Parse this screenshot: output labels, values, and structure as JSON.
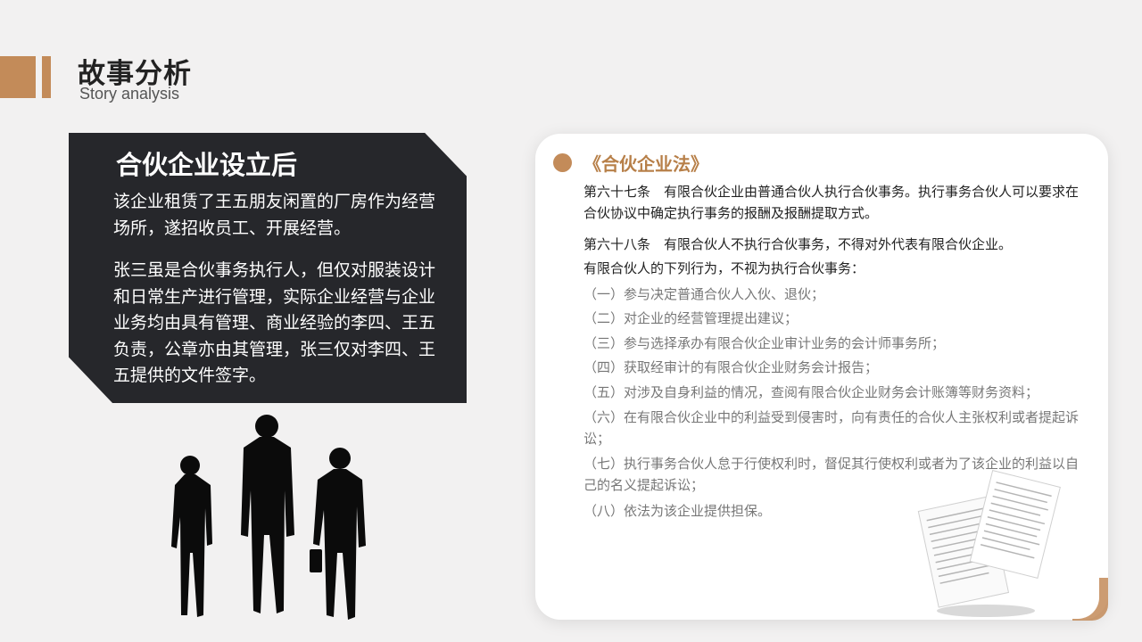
{
  "header": {
    "title": "故事分析",
    "subtitle": "Story analysis"
  },
  "story_card": {
    "heading": "合伙企业设立后",
    "para1": "该企业租赁了王五朋友闲置的厂房作为经营场所，遂招收员工、开展经营。",
    "para2": "张三虽是合伙事务执行人，但仅对服装设计和日常生产进行管理，实际企业经营与企业业务均由具有管理、商业经验的李四、王五负责，公章亦由其管理，张三仅对李四、王五提供的文件签字。"
  },
  "law_card": {
    "title": "《合伙企业法》",
    "article67": "第六十七条　有限合伙企业由普通合伙人执行合伙事务。执行事务合伙人可以要求在合伙协议中确定执行事务的报酬及报酬提取方式。",
    "article68": "第六十八条　有限合伙人不执行合伙事务，不得对外代表有限合伙企业。",
    "intro": "有限合伙人的下列行为，不视为执行合伙事务：",
    "items": [
      "（一）参与决定普通合伙人入伙、退伙；",
      "（二）对企业的经营管理提出建议；",
      "（三）参与选择承办有限合伙企业审计业务的会计师事务所；",
      "（四）获取经审计的有限合伙企业财务会计报告；",
      "（五）对涉及自身利益的情况，查阅有限合伙企业财务会计账簿等财务资料；",
      "（六）在有限合伙企业中的利益受到侵害时，向有责任的合伙人主张权利或者提起诉讼；",
      "（七）执行事务合伙人怠于行使权利时，督促其行使权利或者为了该企业的利益以自己的名义提起诉讼；",
      "（八）依法为该企业提供担保。"
    ]
  },
  "colors": {
    "accent": "#c38b59",
    "dark_card": "#26272b",
    "background": "#f2f1f1"
  }
}
